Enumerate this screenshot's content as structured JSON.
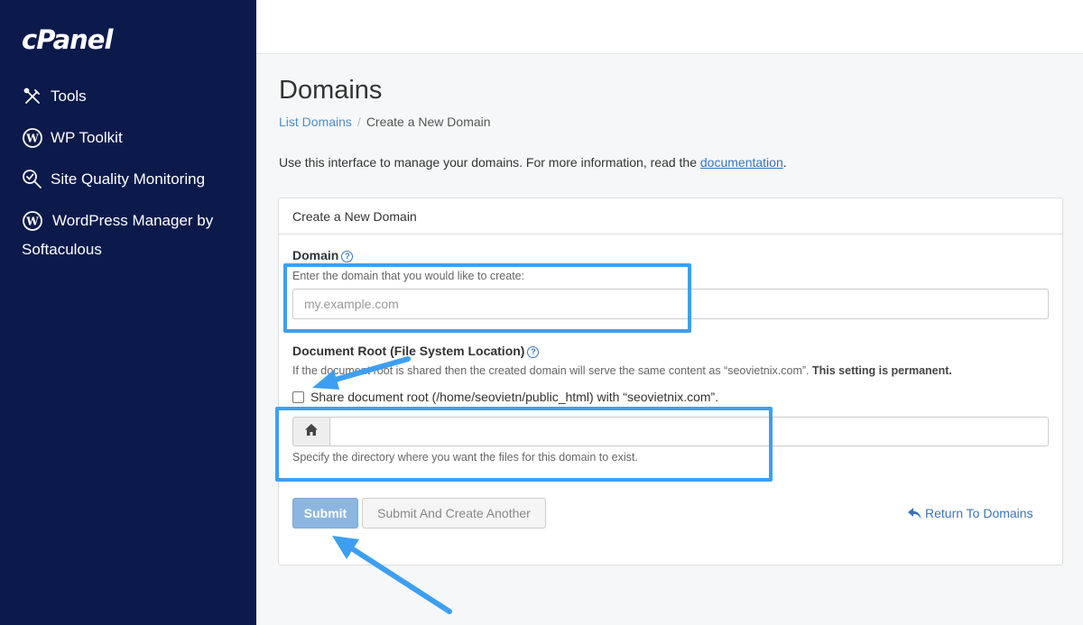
{
  "sidebar": {
    "logo": "cPanel",
    "items": [
      {
        "label": "Tools",
        "icon": "tools-icon"
      },
      {
        "label": "WP Toolkit",
        "icon": "wordpress-icon"
      },
      {
        "label": "Site Quality Monitoring",
        "icon": "site-quality-icon"
      },
      {
        "label": "WordPress Manager by Softaculous",
        "icon": "wordpress-icon"
      }
    ]
  },
  "main": {
    "title": "Domains",
    "breadcrumb": [
      "List Domains",
      "Create a New Domain"
    ],
    "intro_text": "Use this interface to manage your domains. For more information, read the ",
    "intro_link": "documentation",
    "intro_end": "."
  },
  "form": {
    "panel_title": "Create a New Domain",
    "domain_label": "Domain",
    "domain_hint": "Enter the domain that you would like to create:",
    "domain_placeholder": "my.example.com",
    "docroot_label": "Document Root (File System Location)",
    "docroot_hint": "If the document root is shared then the created domain will serve the same content as “seovietnix.com”.",
    "docroot_hint_bold": "This setting is permanent.",
    "share_checkbox_label": "Share document root (/home/seovietn/public_html) with “seovietnix.com”.",
    "docroot_help": "Specify the directory where you want the files for this domain to exist.",
    "submit_label": "Submit",
    "submit_another_label": "Submit And Create Another",
    "return_label": "Return To Domains"
  },
  "colors": {
    "sidebar_bg": "#0c1a4b",
    "link": "#3a74b8",
    "highlight": "#3d9ff1",
    "submit_bg": "#8cb6e0"
  }
}
